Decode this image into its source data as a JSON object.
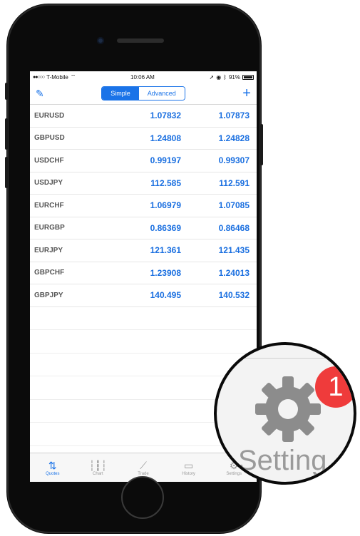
{
  "statusbar": {
    "carrier": "T-Mobile",
    "time": "10:06 AM",
    "battery": "91%"
  },
  "toolbar": {
    "tab_simple": "Simple",
    "tab_advanced": "Advanced"
  },
  "quotes": [
    {
      "symbol": "EURUSD",
      "bid": "1.07832",
      "ask": "1.07873"
    },
    {
      "symbol": "GBPUSD",
      "bid": "1.24808",
      "ask": "1.24828"
    },
    {
      "symbol": "USDCHF",
      "bid": "0.99197",
      "ask": "0.99307"
    },
    {
      "symbol": "USDJPY",
      "bid": "112.585",
      "ask": "112.591"
    },
    {
      "symbol": "EURCHF",
      "bid": "1.06979",
      "ask": "1.07085"
    },
    {
      "symbol": "EURGBP",
      "bid": "0.86369",
      "ask": "0.86468"
    },
    {
      "symbol": "EURJPY",
      "bid": "121.361",
      "ask": "121.435"
    },
    {
      "symbol": "GBPCHF",
      "bid": "1.23908",
      "ask": "1.24013"
    },
    {
      "symbol": "GBPJPY",
      "bid": "140.495",
      "ask": "140.532"
    }
  ],
  "tabs": [
    {
      "label": "Quotes",
      "icon": "quotes-icon"
    },
    {
      "label": "Chart",
      "icon": "chart-icon"
    },
    {
      "label": "Trade",
      "icon": "trade-icon"
    },
    {
      "label": "History",
      "icon": "history-icon"
    },
    {
      "label": "Settings",
      "icon": "gear-icon"
    }
  ],
  "zoom": {
    "badge": "1",
    "label": "Setting"
  },
  "colors": {
    "accent": "#1a73e8",
    "badge": "#ef3b3b",
    "price": "#1a6fe0"
  }
}
